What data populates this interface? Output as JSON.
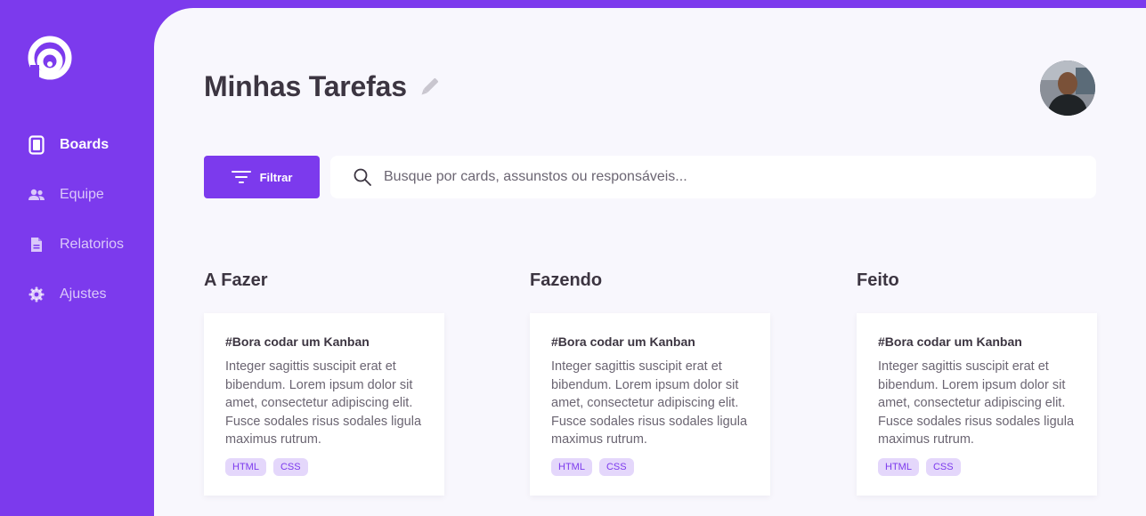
{
  "colors": {
    "accent": "#7c3aed",
    "background": "#f8f7fd",
    "tag_bg": "#e4d7fb",
    "text": "#3c3541"
  },
  "sidebar": {
    "logo_icon": "logo-icon",
    "items": [
      {
        "label": "Boards",
        "icon": "board-icon",
        "active": true
      },
      {
        "label": "Equipe",
        "icon": "people-icon",
        "active": false
      },
      {
        "label": "Relatorios",
        "icon": "document-icon",
        "active": false
      },
      {
        "label": "Ajustes",
        "icon": "gear-icon",
        "active": false
      }
    ]
  },
  "header": {
    "title": "Minhas Tarefas",
    "edit_icon": "pencil-icon",
    "avatar": "user-avatar"
  },
  "toolbar": {
    "filter_label": "Filtrar",
    "filter_icon": "filter-icon",
    "search_placeholder": "Busque por cards, assunstos ou responsáveis...",
    "search_value": ""
  },
  "columns": [
    {
      "title": "A Fazer",
      "cards": [
        {
          "title": "#Bora codar um Kanban",
          "description": "Integer sagittis suscipit erat et bibendum. Lorem ipsum dolor sit amet, consectetur adipiscing elit. Fusce sodales risus sodales ligula maximus rutrum.",
          "tags": [
            "HTML",
            "CSS"
          ]
        }
      ]
    },
    {
      "title": "Fazendo",
      "cards": [
        {
          "title": "#Bora codar um Kanban",
          "description": "Integer sagittis suscipit erat et bibendum. Lorem ipsum dolor sit amet, consectetur adipiscing elit. Fusce sodales risus sodales ligula maximus rutrum.",
          "tags": [
            "HTML",
            "CSS"
          ]
        }
      ]
    },
    {
      "title": "Feito",
      "cards": [
        {
          "title": "#Bora codar um Kanban",
          "description": "Integer sagittis suscipit erat et bibendum. Lorem ipsum dolor sit amet, consectetur adipiscing elit. Fusce sodales risus sodales ligula maximus rutrum.",
          "tags": [
            "HTML",
            "CSS"
          ]
        }
      ]
    }
  ]
}
